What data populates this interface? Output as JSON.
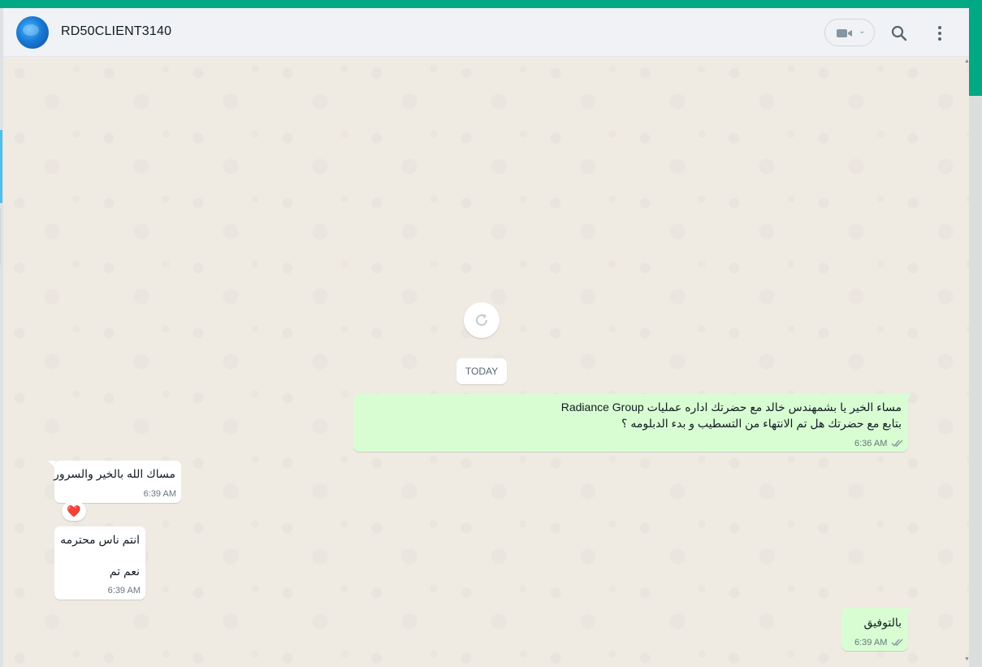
{
  "header": {
    "contact_name": "RD50CLIENT3140",
    "video_call_label": "video",
    "icons": [
      "avatar",
      "video-camera-icon",
      "chevron-down-icon",
      "search-icon",
      "menu-dots-icon"
    ]
  },
  "chat": {
    "date_label": "TODAY",
    "messages": [
      {
        "direction": "outgoing",
        "line1": "مساء الخير يا بشمهندس خالد مع  حضرتك اداره عمليات Radiance Group",
        "line2": "بتابع مع حضرتك هل تم الانتهاء من التسطيب و بدء الدبلومه ؟",
        "time": "6:36 AM",
        "status": "read"
      },
      {
        "direction": "incoming",
        "line1": "مساك الله بالخير والسرور",
        "time": "6:39 AM",
        "reaction": "❤️"
      },
      {
        "direction": "incoming",
        "line1": "انتم ناس محترمه",
        "line2": "نعم تم",
        "time": "6:39 AM"
      },
      {
        "direction": "outgoing",
        "line1": "بالتوفيق",
        "time": "6:39 AM",
        "status": "read"
      }
    ]
  },
  "colors": {
    "accent": "#00a884",
    "outgoing_bubble": "#d9fdd3",
    "incoming_bubble": "#ffffff",
    "chat_background": "#efeae2",
    "header_background": "#f0f2f5"
  }
}
